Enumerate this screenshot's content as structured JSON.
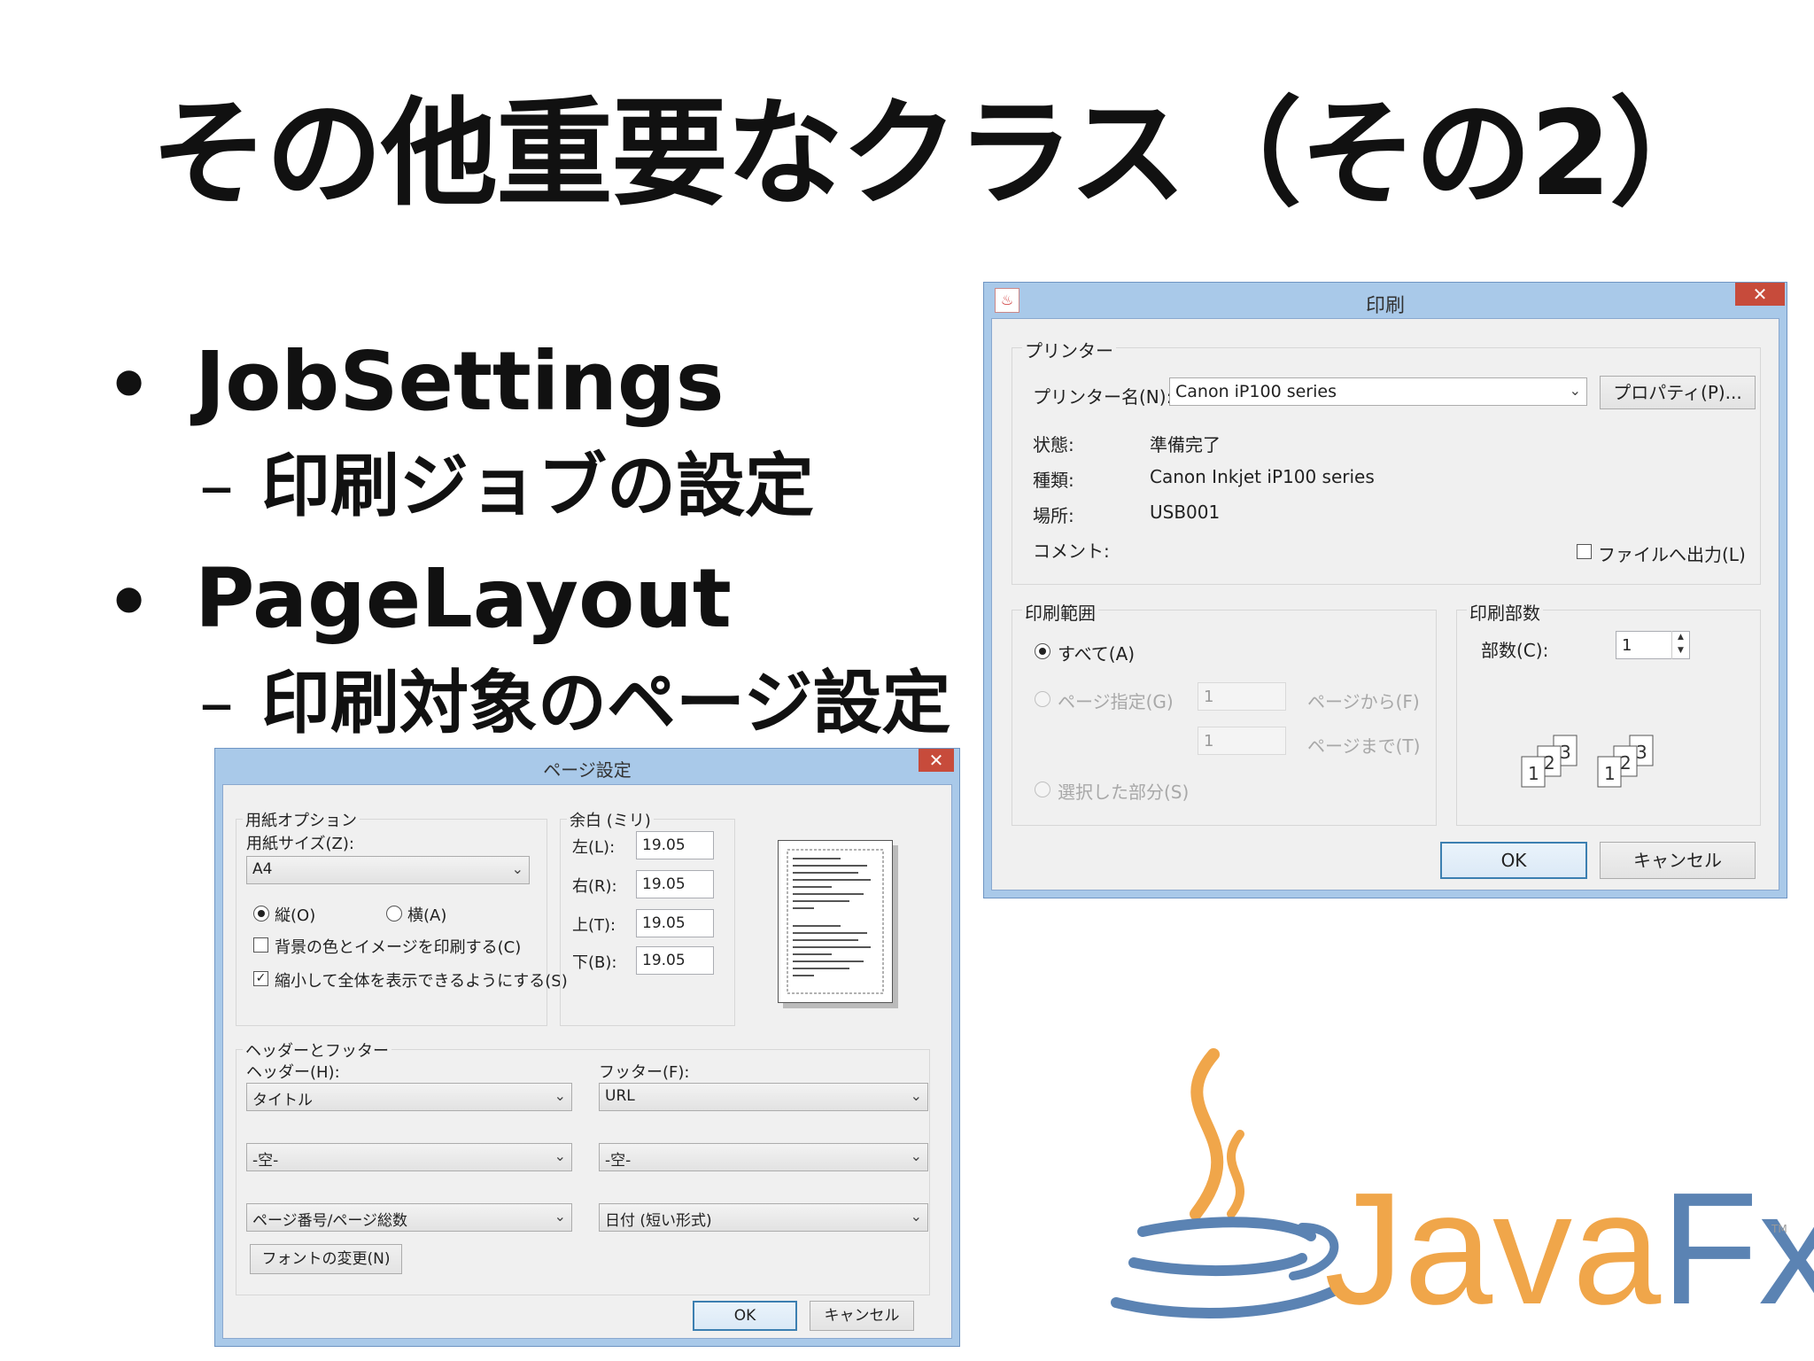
{
  "slide": {
    "title": "その他重要なクラス（その2）",
    "bullets": [
      {
        "label": "JobSettings",
        "sub": "印刷ジョブの設定"
      },
      {
        "label": "PageLayout",
        "sub": "印刷対象のページ設定"
      }
    ],
    "bullet_symbol": "•",
    "dash_symbol": "–"
  },
  "print_dialog": {
    "title": "印刷",
    "close": "✕",
    "printer_group": "プリンター",
    "printer_name_label": "プリンター名(N):",
    "printer_name_value": "Canon iP100 series",
    "properties_button": "プロパティ(P)...",
    "status_label": "状態:",
    "status_value": "準備完了",
    "type_label": "種類:",
    "type_value": "Canon Inkjet iP100 series",
    "location_label": "場所:",
    "location_value": "USB001",
    "comment_label": "コメント:",
    "print_to_file": "ファイルへ出力(L)",
    "range_group": "印刷範囲",
    "range_all": "すべて(A)",
    "range_pages": "ページ指定(G)",
    "page_from_value": "1",
    "page_from_label": "ページから(F)",
    "page_to_value": "1",
    "page_to_label": "ページまで(T)",
    "range_selection": "選択した部分(S)",
    "copies_group": "印刷部数",
    "copies_label": "部数(C):",
    "copies_value": "1",
    "ok": "OK",
    "cancel": "キャンセル"
  },
  "page_setup_dialog": {
    "title": "ページ設定",
    "close": "✕",
    "paper_options_group": "用紙オプション",
    "paper_size_label": "用紙サイズ(Z):",
    "paper_size_value": "A4",
    "portrait": "縦(O)",
    "landscape": "横(A)",
    "print_background": "背景の色とイメージを印刷する(C)",
    "shrink_to_fit": "縮小して全体を表示できるようにする(S)",
    "margins_group": "余白 (ミリ)",
    "left_label": "左(L):",
    "left_value": "19.05",
    "right_label": "右(R):",
    "right_value": "19.05",
    "top_label": "上(T):",
    "top_value": "19.05",
    "bottom_label": "下(B):",
    "bottom_value": "19.05",
    "header_footer_group": "ヘッダーとフッター",
    "header_label": "ヘッダー(H):",
    "footer_label": "フッター(F):",
    "header_values": [
      "タイトル",
      "-空-",
      "ページ番号/ページ総数"
    ],
    "footer_values": [
      "URL",
      "-空-",
      "日付 (短い形式)"
    ],
    "font_button": "フォントの変更(N)",
    "ok": "OK",
    "cancel": "キャンセル"
  },
  "logo": {
    "text_java": "Java",
    "text_fx": "Fx",
    "tm": "TM",
    "color_orange": "#f0a64a",
    "color_blue": "#5b83b3"
  }
}
